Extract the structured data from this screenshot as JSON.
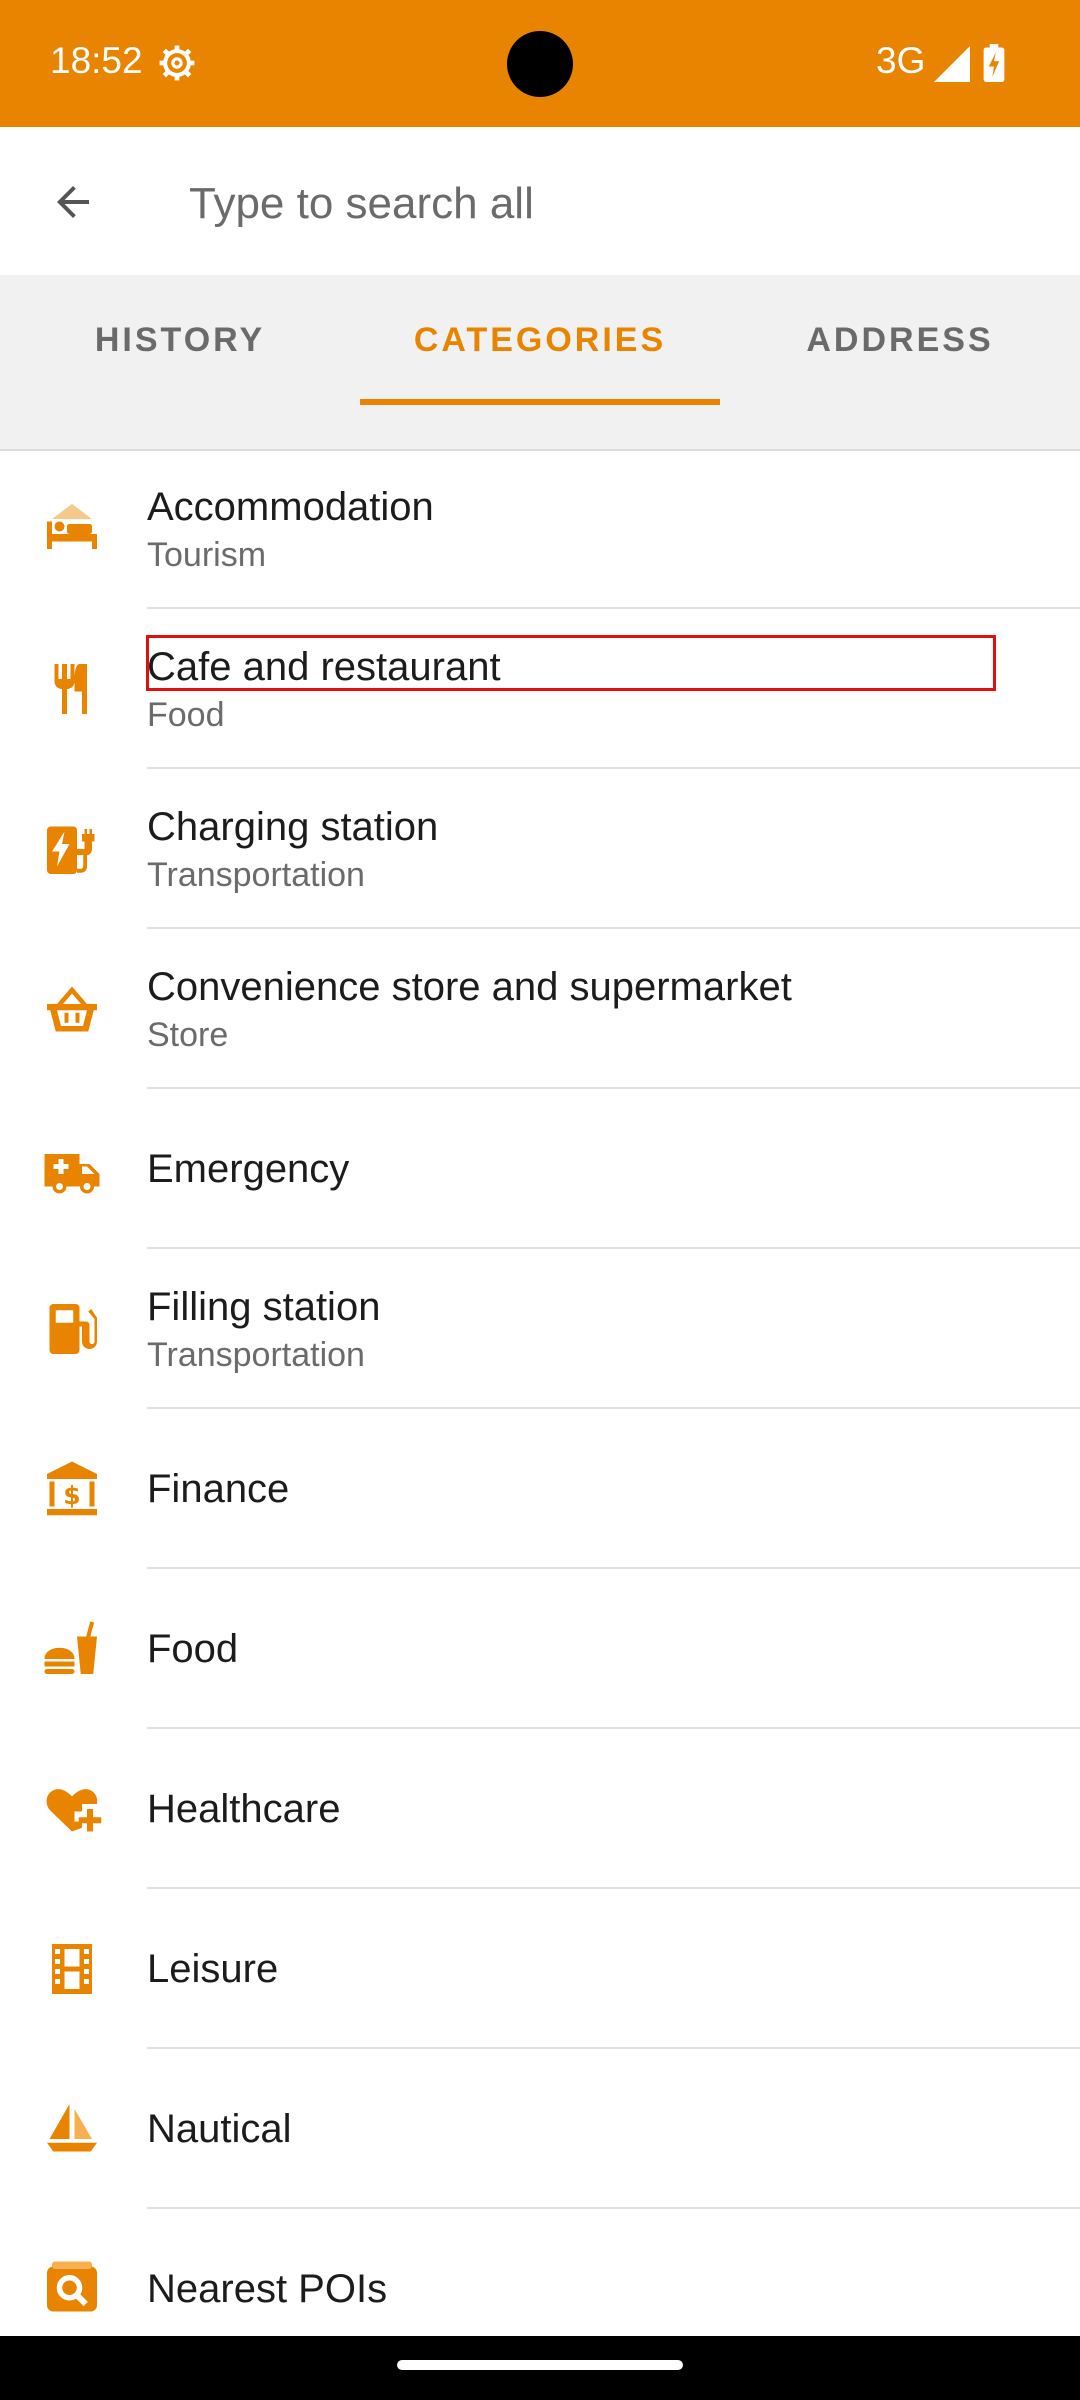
{
  "status_bar": {
    "time": "18:52",
    "network": "3G"
  },
  "search": {
    "placeholder": "Type to search all"
  },
  "tabs": [
    {
      "label": "HISTORY",
      "active": false
    },
    {
      "label": "CATEGORIES",
      "active": true
    },
    {
      "label": "ADDRESS",
      "active": false
    }
  ],
  "categories": [
    {
      "title": "Accommodation",
      "subtitle": "Tourism",
      "icon": "bed-icon"
    },
    {
      "title": "Cafe and restaurant",
      "subtitle": "Food",
      "icon": "fork-knife-icon"
    },
    {
      "title": "Charging station",
      "subtitle": "Transportation",
      "icon": "charging-station-icon"
    },
    {
      "title": "Convenience store and supermarket",
      "subtitle": "Store",
      "icon": "basket-icon"
    },
    {
      "title": "Emergency",
      "subtitle": "",
      "icon": "ambulance-icon"
    },
    {
      "title": "Filling station",
      "subtitle": "Transportation",
      "icon": "fuel-pump-icon"
    },
    {
      "title": "Finance",
      "subtitle": "",
      "icon": "bank-icon"
    },
    {
      "title": "Food",
      "subtitle": "",
      "icon": "fast-food-icon"
    },
    {
      "title": "Healthcare",
      "subtitle": "",
      "icon": "heart-plus-icon"
    },
    {
      "title": "Leisure",
      "subtitle": "",
      "icon": "film-icon"
    },
    {
      "title": "Nautical",
      "subtitle": "",
      "icon": "sailboat-icon"
    },
    {
      "title": "Nearest POIs",
      "subtitle": "",
      "icon": "search-poi-icon"
    }
  ],
  "colors": {
    "accent": "#E88400",
    "highlight": "#E01010"
  }
}
